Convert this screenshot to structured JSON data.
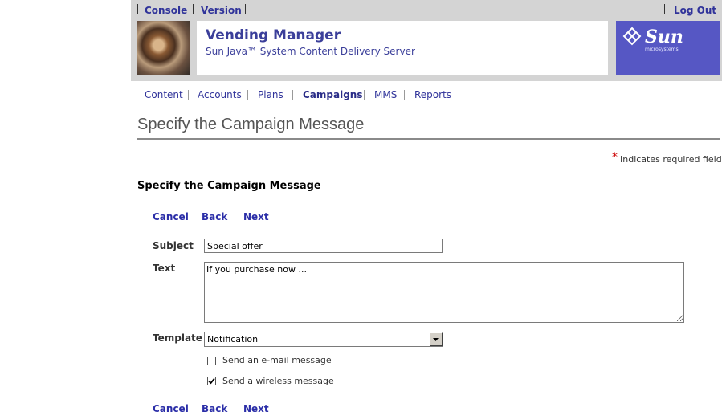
{
  "topbar": {
    "console_label": "Console",
    "version_label": "Version",
    "logout_label": "Log Out"
  },
  "masthead": {
    "app_title": "Vending Manager",
    "app_subtitle": "Sun Java™ System Content Delivery Server",
    "logo_text": "Sun",
    "logo_sub": "microsystems"
  },
  "nav": {
    "items": [
      {
        "label": "Content"
      },
      {
        "label": "Accounts"
      },
      {
        "label": "Plans"
      },
      {
        "label": "Campaigns"
      },
      {
        "label": "MMS"
      },
      {
        "label": "Reports"
      }
    ],
    "active": "Campaigns"
  },
  "page": {
    "title": "Specify the Campaign Message",
    "required_star": "*",
    "required_note": "Indicates required field",
    "section_title": "Specify the Campaign Message"
  },
  "actions_top": {
    "cancel": "Cancel",
    "back": "Back",
    "next": "Next"
  },
  "actions_bottom": {
    "cancel": "Cancel",
    "back": "Back",
    "next": "Next"
  },
  "form": {
    "subject_label": "Subject",
    "subject_value": "Special offer",
    "text_label": "Text",
    "text_value": "If you purchase now ...",
    "template_label": "Template",
    "template_value": "Notification",
    "email_label": "Send an e-mail message",
    "email_checked": false,
    "wireless_label": "Send a wireless message",
    "wireless_checked": true
  },
  "colors": {
    "link": "#30339a",
    "header_bg": "#d4d4d4",
    "sun_bg": "#5657c4",
    "required": "#cc0000"
  }
}
